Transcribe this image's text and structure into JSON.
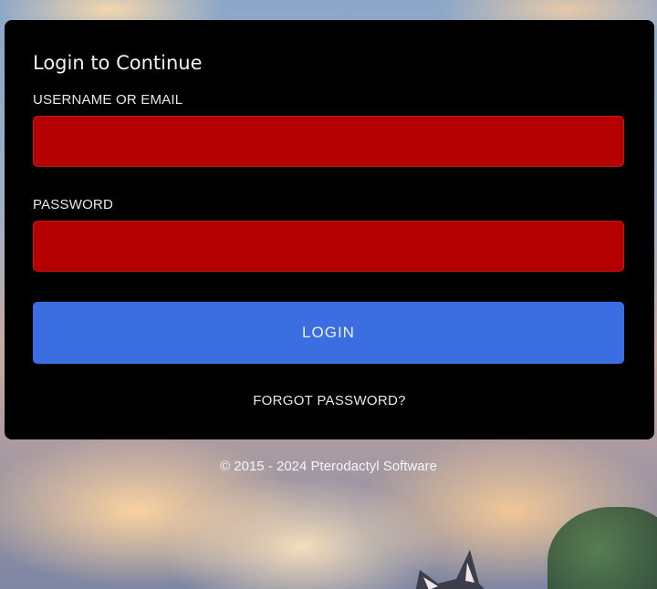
{
  "login_form": {
    "title": "Login to Continue",
    "username_label": "USERNAME OR EMAIL",
    "username_value": "",
    "password_label": "PASSWORD",
    "password_value": "",
    "login_button": "LOGIN",
    "forgot_link": "FORGOT PASSWORD?"
  },
  "footer": {
    "copyright": "© 2015 - 2024",
    "brand_link": "Pterodactyl Software"
  },
  "colors": {
    "card_background": "#000000",
    "input_background": "#b40000",
    "login_button": "#3b6ee0"
  },
  "icons": {
    "background_illustration": "anime-sky-with-cat"
  }
}
